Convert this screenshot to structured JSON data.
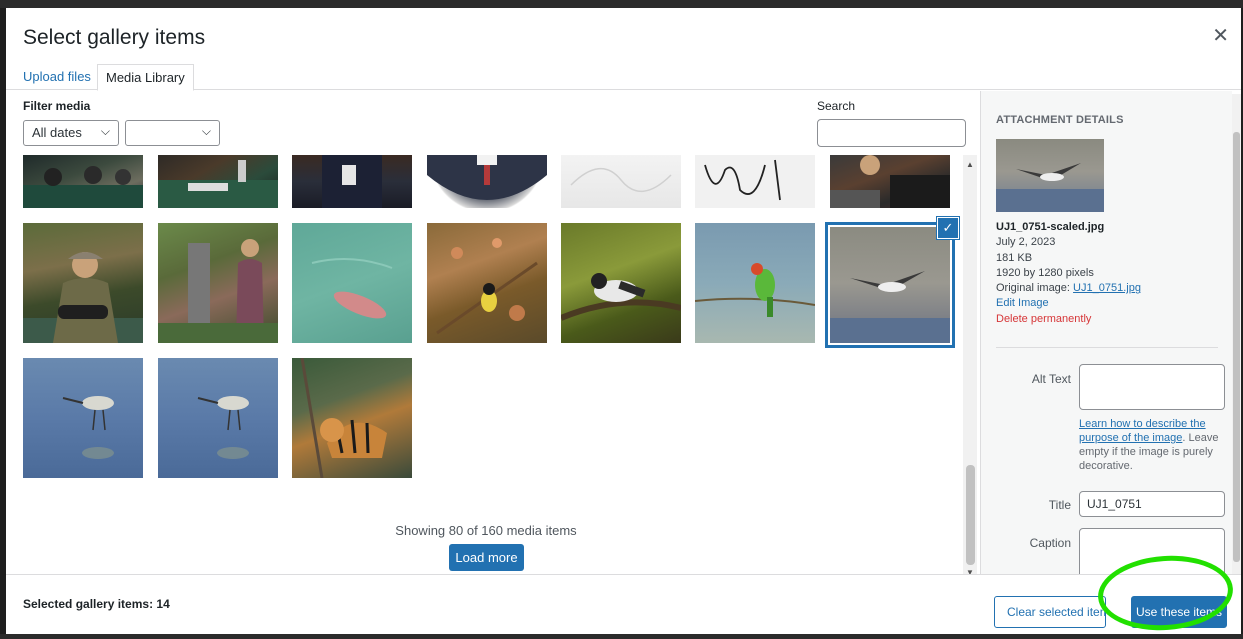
{
  "modal": {
    "title": "Select gallery items",
    "close_glyph": "✕",
    "tabs": [
      {
        "label": "Upload files"
      },
      {
        "label": "Media Library"
      }
    ]
  },
  "toolbar": {
    "filter_label": "Filter media",
    "date_filter_value": "All dates",
    "type_filter_value": "",
    "search_label": "Search",
    "chevron_glyph": "⌵"
  },
  "grid": {
    "selected_check_glyph": "✓",
    "showing_text": "Showing 80 of 160 media items",
    "load_more_label": "Load more"
  },
  "attachment": {
    "heading": "ATTACHMENT DETAILS",
    "filename": "UJ1_0751-scaled.jpg",
    "date": "July 2, 2023",
    "size": "181 KB",
    "dimensions": "1920 by 1280 pixels",
    "original_label": "Original image:",
    "original_link": "UJ1_0751.jpg",
    "edit_label": "Edit Image",
    "delete_label": "Delete permanently",
    "alt_label": "Alt Text",
    "alt_help_link": "Learn how to describe the purpose of the image",
    "alt_help_text": ". Leave empty if the image is purely decorative.",
    "title_label": "Title",
    "title_value": "UJ1_0751",
    "caption_label": "Caption"
  },
  "footer": {
    "selected_count": "Selected gallery items: 14",
    "clear_label": "Clear selected item",
    "use_label": "Use these items"
  },
  "colors": {
    "accent": "#2271b1",
    "danger": "#d63638",
    "highlight": "#22e000"
  }
}
